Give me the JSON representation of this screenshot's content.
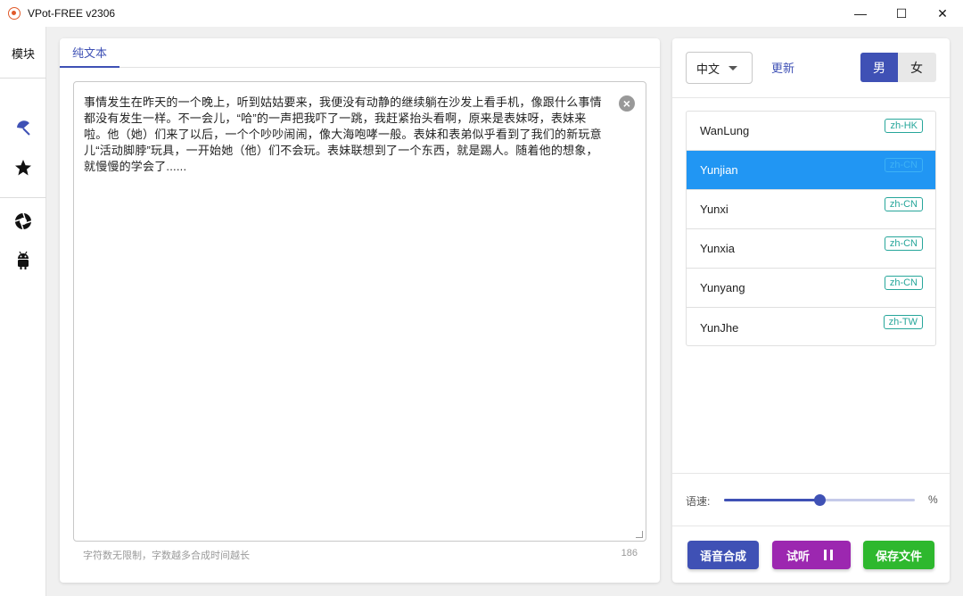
{
  "window": {
    "title": "VPot-FREE v2306",
    "minimize": "—",
    "maximize": "☐",
    "close": "✕"
  },
  "nav": {
    "title": "模块",
    "icons": [
      "umbrella-icon",
      "star-icon",
      "aperture-icon",
      "android-icon"
    ]
  },
  "editor": {
    "tab": "纯文本",
    "text": "事情发生在昨天的一个晚上，听到姑姑要来，我便没有动静的继续躺在沙发上看手机，像跟什么事情都没有发生一样。不一会儿，“哈”的一声把我吓了一跳，我赶紧抬头看啊，原来是表妹呀，表妹来啦。他（她）们来了以后，一个个吵吵闹闹，像大海咆哮一般。表妹和表弟似乎看到了我们的新玩意儿“活动脚脖”玩具，一开始她（他）们不会玩。表妹联想到了一个东西，就是踢人。随着他的想象，就慢慢的学会了......",
    "hint": "字符数无限制，字数越多合成时间越长",
    "count": "186"
  },
  "settings": {
    "language": "中文",
    "update": "更新",
    "gender": {
      "male": "男",
      "female": "女",
      "selected": "male"
    },
    "voices": [
      {
        "name": "WanLung",
        "locale": "zh-HK"
      },
      {
        "name": "Yunjian",
        "locale": "zh-CN",
        "selected": true
      },
      {
        "name": "Yunxi",
        "locale": "zh-CN"
      },
      {
        "name": "Yunxia",
        "locale": "zh-CN"
      },
      {
        "name": "Yunyang",
        "locale": "zh-CN"
      },
      {
        "name": "YunJhe",
        "locale": "zh-TW"
      }
    ],
    "speed_label": "语速:",
    "speed_unit": "%",
    "speed_fraction": 0.5,
    "buttons": {
      "synthesize": "语音合成",
      "listen": "试听",
      "save": "保存文件"
    }
  },
  "colors": {
    "primary": "#3f51b5",
    "selected_row": "#2196f3",
    "listen": "#9c27b0",
    "save": "#2eb82e",
    "tag": "#26a69a"
  }
}
